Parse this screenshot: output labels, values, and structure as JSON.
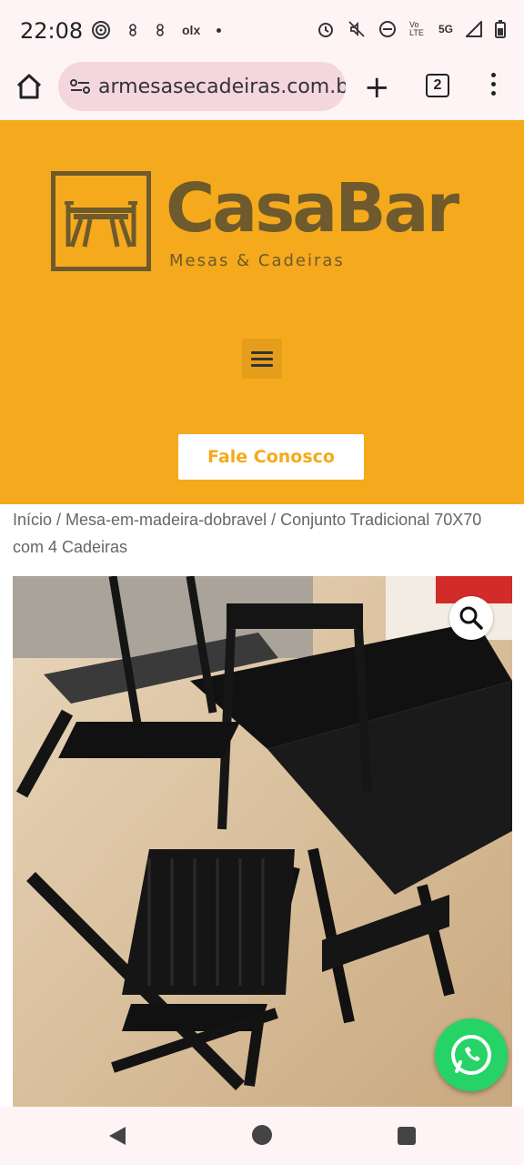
{
  "status_bar": {
    "time": "22:08",
    "left_icons": [
      "wifi-calling-icon",
      "app-icon-1",
      "app-icon-2",
      "olx-icon",
      "dot-icon"
    ],
    "olx_label": "olx",
    "network": "5G",
    "volte": "Vo LTE"
  },
  "browser": {
    "url": "armesasecadeiras.com.br",
    "tab_count": "2"
  },
  "header": {
    "brand": "CasaBar",
    "tagline": "Mesas & Cadeiras",
    "cta_label": "Fale Conosco"
  },
  "breadcrumb": {
    "text": "Início / Mesa-em-madeira-dobravel / Conjunto Tradicional 70X70 com 4 Cadeiras"
  },
  "colors": {
    "brand_orange": "#f5a91c",
    "brand_brown": "#6e5a2c",
    "whatsapp_green": "#25d366"
  }
}
